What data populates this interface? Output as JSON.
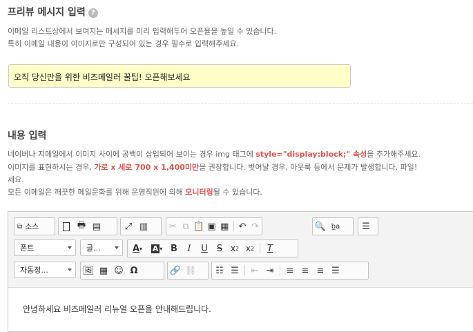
{
  "preview": {
    "title": "프리뷰 메시지 입력",
    "help": "?",
    "desc1": "이메일 리스트상에서 보여지는 메세지를 미리 입력해두어 오픈율을 높일 수 있습니다.",
    "desc2": "특히 이메일 내용이 이미지로만 구성되어 있는 경우 필수로 입력해주세요.",
    "value": "오직 당신만을 위한 비즈메일러 꿀팁! 오픈해보세요"
  },
  "content": {
    "title": "내용 입력",
    "line1_a": "네이버나 지메일에서 이미지 사이에 공백이 삽입되어 보이는 경우 img 태그에 ",
    "line1_hl": "style=\"display:block;\" 속성",
    "line1_b": "을 추가해주세요.",
    "line2_a": "이미지를 표현하시는 경우, ",
    "line2_hl": "가로 x 세로 700 x 1,400미만",
    "line2_b": "을 권장합니다. 벗어날 경우, 아웃룩 등에서 문제가 발생합니다. 파일!",
    "line3": "세요.",
    "line4_a": "모든 이메일은 깨끗한 메일문화를 위해 운영직원에 의해 ",
    "line4_hl": "모니터링",
    "line4_b": "될 수 있습니다."
  },
  "editor": {
    "source_label": "소스",
    "format_label": "폰트",
    "size_label": "글...",
    "style_label": "자동정...",
    "body_text": "안녕하세요 비즈메일러 리뉴얼 오픈을 안내해드립니다."
  },
  "colors": {
    "highlight": "#e2524d",
    "preview_bg": "#ffffc8"
  }
}
